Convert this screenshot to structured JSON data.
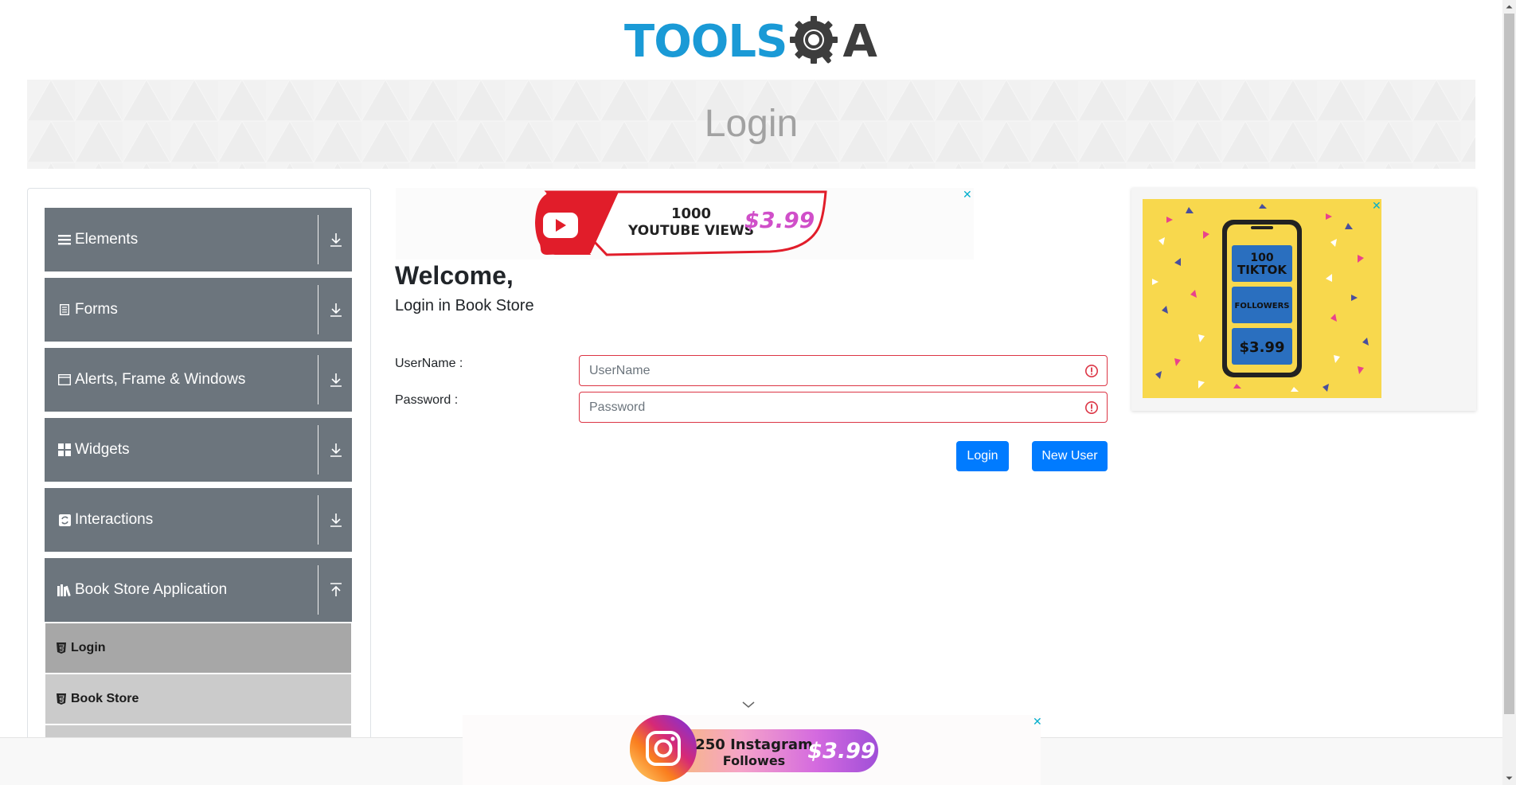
{
  "header": {
    "logo_text": "TOOLS",
    "logo_text_suffix": "A",
    "logo_color": "#1a9ad6",
    "logo_dark_color": "#3d3d3d"
  },
  "banner": {
    "title": "Login"
  },
  "sidebar": {
    "groups": [
      {
        "label": "Elements",
        "icon": "list-icon",
        "expanded": false
      },
      {
        "label": "Forms",
        "icon": "form-icon",
        "expanded": false
      },
      {
        "label": "Alerts, Frame & Windows",
        "icon": "window-icon",
        "expanded": false
      },
      {
        "label": "Widgets",
        "icon": "widgets-icon",
        "expanded": false
      },
      {
        "label": "Interactions",
        "icon": "interactions-icon",
        "expanded": false
      },
      {
        "label": "Book Store Application",
        "icon": "books-icon",
        "expanded": true
      }
    ],
    "book_store_items": [
      {
        "label": "Login",
        "active": true
      },
      {
        "label": "Book Store",
        "active": false
      }
    ],
    "group_color": "#6c757d",
    "active_item_color": "#a7a7a7",
    "item_color": "#cbcbcb"
  },
  "ads": {
    "top": {
      "line1": "1000",
      "line2": "YOUTUBE VIEWS",
      "price": "$3.99"
    },
    "right": {
      "line1": "100",
      "line2": "TIKTOK",
      "line3": "FOLLOWERS",
      "price": "$3.99"
    },
    "bottom": {
      "line1": "250 Instagram",
      "line2": "Followes",
      "price": "$3.99"
    },
    "close_symbol": "✕"
  },
  "login": {
    "welcome": "Welcome,",
    "subtitle": "Login in Book Store",
    "username_label": "UserName :",
    "username_placeholder": "UserName",
    "username_value": "",
    "password_label": "Password :",
    "password_placeholder": "Password",
    "password_value": "",
    "login_button": "Login",
    "new_user_button": "New User",
    "primary_color": "#007bff",
    "error_color": "#dc3545"
  }
}
